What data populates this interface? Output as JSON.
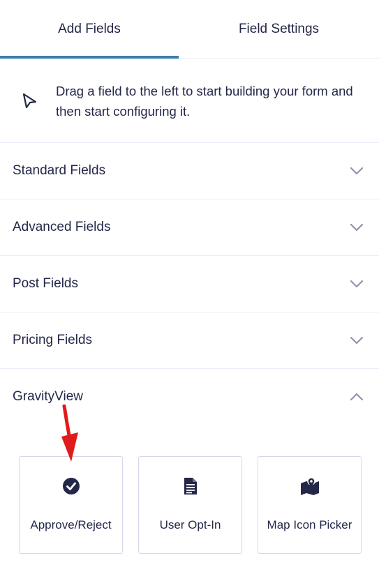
{
  "tabs": [
    {
      "label": "Add Fields",
      "active": true
    },
    {
      "label": "Field Settings",
      "active": false
    }
  ],
  "hint": {
    "text": "Drag a field to the left to start building your form and then start configuring it.",
    "icon": "cursor-arrow-icon"
  },
  "sections": [
    {
      "label": "Standard Fields",
      "expanded": false
    },
    {
      "label": "Advanced Fields",
      "expanded": false
    },
    {
      "label": "Post Fields",
      "expanded": false
    },
    {
      "label": "Pricing Fields",
      "expanded": false
    },
    {
      "label": "GravityView",
      "expanded": true
    }
  ],
  "gravityview_fields": [
    {
      "label": "Approve/Reject",
      "icon": "check-circle-icon"
    },
    {
      "label": "User Opt-In",
      "icon": "document-icon"
    },
    {
      "label": "Map Icon Picker",
      "icon": "map-pin-icon"
    }
  ],
  "colors": {
    "accent": "#3e7da6",
    "text": "#242748",
    "chevron": "#9092b2",
    "annotation_arrow": "#e01b1b"
  }
}
